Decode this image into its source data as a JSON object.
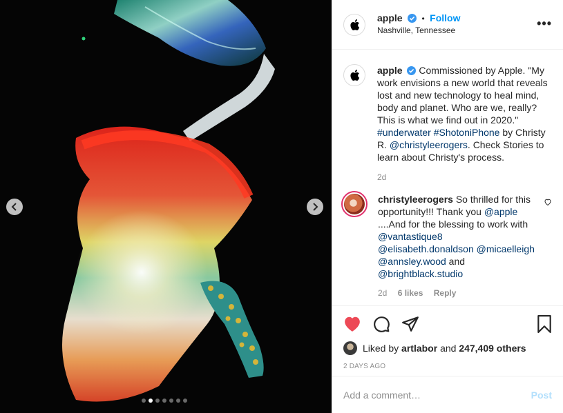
{
  "media": {
    "image_alt": "Underwater photo of a person in a flowing rainbow-colored tulle dress reaching toward an iridescent fabric",
    "slide_count": 7,
    "active_slide": 2,
    "prev_icon": "chevron-left-icon",
    "next_icon": "chevron-right-icon"
  },
  "header": {
    "username": "apple",
    "separator": "•",
    "follow_label": "Follow",
    "location": "Nashville, Tennessee",
    "more_icon": "more-options-icon",
    "more_label": "•••"
  },
  "caption": {
    "username": "apple",
    "text_before": "Commissioned by Apple. \"My work envisions a new world that reveals lost and new technology to heal mind, body and planet. Who are we, really? This is what we find out in 2020.\" ",
    "hashtag1": "#underwater",
    "hashtag2": "#ShotoniPhone",
    "text_mid": " by Christy R. ",
    "mention": "@christyleerogers",
    "text_after": ". Check Stories to learn about Christy's process.",
    "age": "2d"
  },
  "comment": {
    "username": "christyleerogers",
    "text_before": "So thrilled for this opportunity!!! Thank you ",
    "mention1": "@apple",
    "text_mid": " ....And for the blessing to work with ",
    "mention2": "@vantastique8",
    "mention3": "@elisabeth.donaldson",
    "mention4": "@micaelleigh",
    "mention5": "@annsley.wood",
    "text_and": " and ",
    "mention6": "@brightblack.studio",
    "age": "2d",
    "likes": "6 likes",
    "reply_label": "Reply"
  },
  "actions": {
    "like_icon": "heart-filled-icon",
    "comment_icon": "comment-icon",
    "share_icon": "share-icon",
    "save_icon": "bookmark-icon",
    "liked_color": "#ed4956"
  },
  "likes": {
    "prefix": "Liked by ",
    "user": "artlabor",
    "middle": " and ",
    "others": "247,409 others"
  },
  "timestamp": "2 DAYS AGO",
  "add_comment": {
    "placeholder": "Add a comment…",
    "post_label": "Post"
  },
  "colors": {
    "link": "#00376b",
    "follow": "#0095f6",
    "verified": "#3897f0",
    "post_disabled": "#b2dffc"
  }
}
